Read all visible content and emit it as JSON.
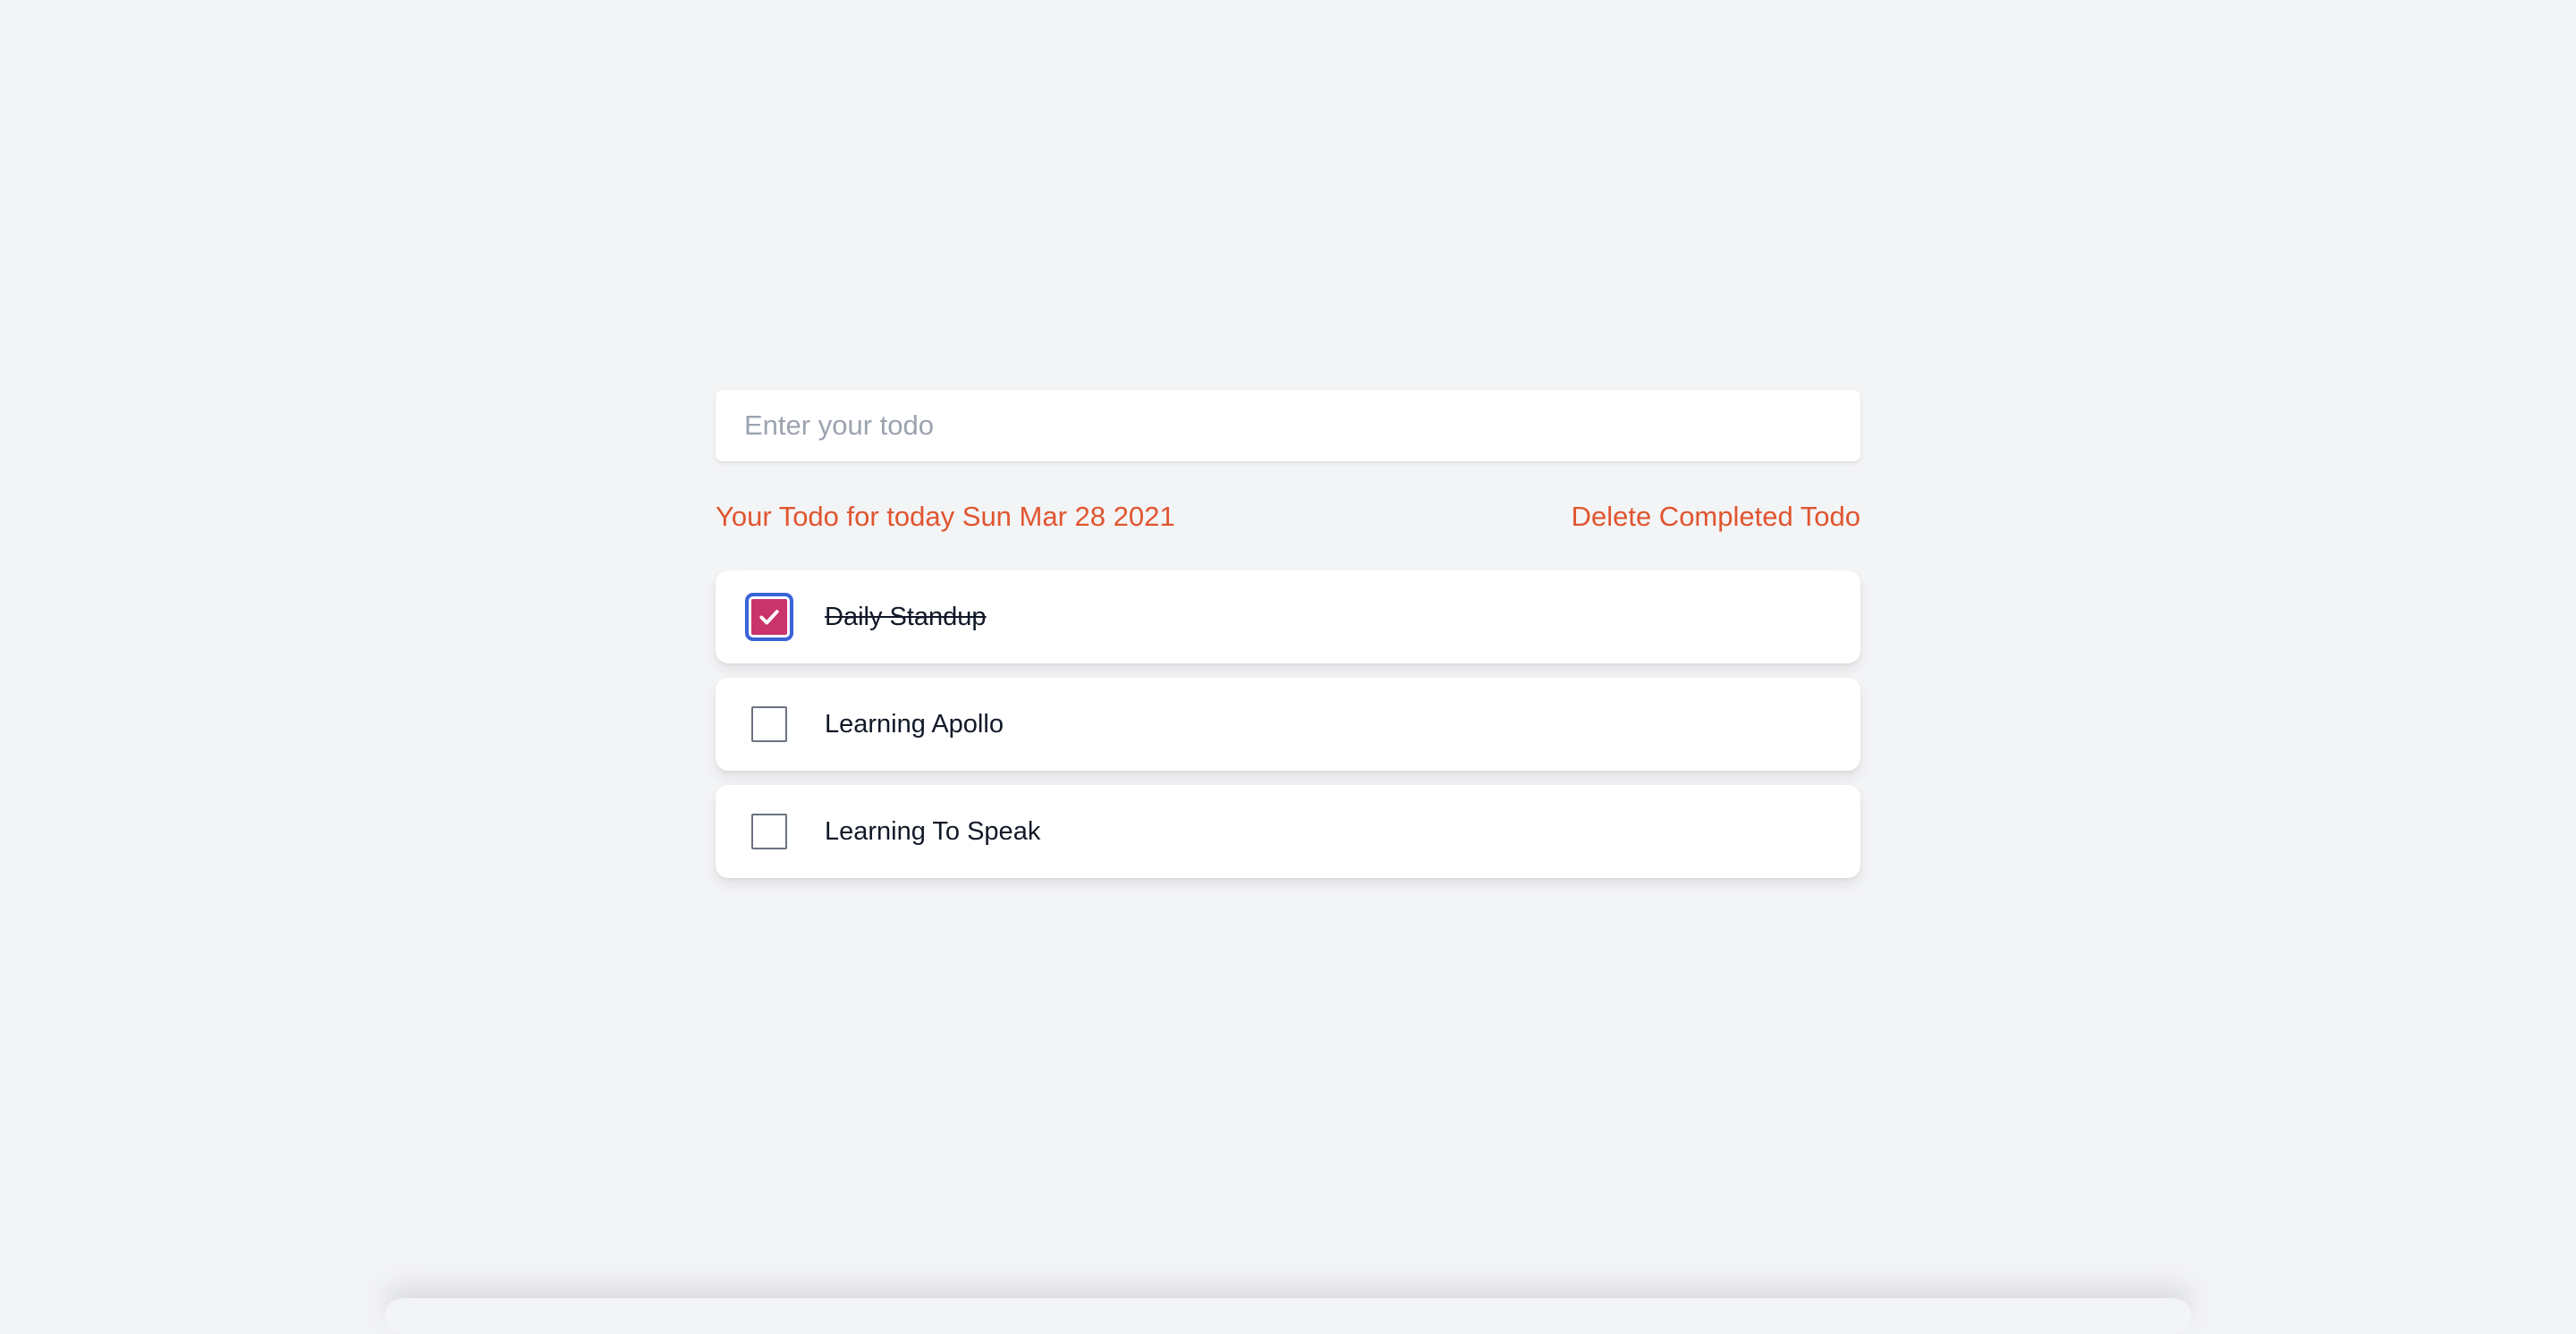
{
  "input": {
    "placeholder": "Enter your todo",
    "value": ""
  },
  "header": {
    "title": "Your Todo for today Sun Mar 28 2021",
    "delete_label": "Delete Completed Todo"
  },
  "todos": [
    {
      "text": "Daily Standup",
      "completed": true
    },
    {
      "text": "Learning Apollo",
      "completed": false
    },
    {
      "text": "Learning To Speak",
      "completed": false
    }
  ],
  "colors": {
    "accent": "#e0552f",
    "checkbox_checked": "#c9356b",
    "focus_ring": "#3b63d9",
    "background": "#f3f4f6"
  },
  "icons": {
    "check": "check-icon"
  }
}
